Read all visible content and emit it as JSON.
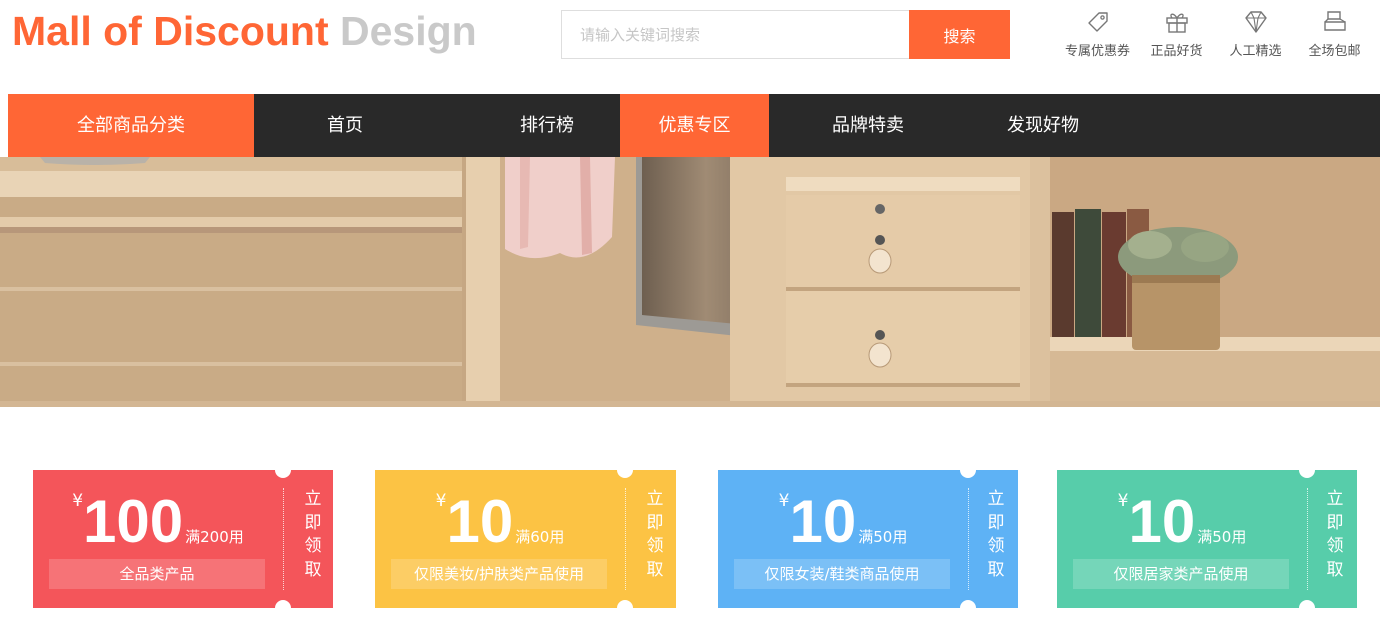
{
  "brand": {
    "part1": "Mall of Discount",
    "part2": "Design",
    "accent_color": "#ff6635"
  },
  "search": {
    "placeholder": "请输入关键词搜索",
    "value": "",
    "button_label": "搜索"
  },
  "features": [
    {
      "icon": "coupon-tag-icon",
      "label": "专属优惠券"
    },
    {
      "icon": "gift-icon",
      "label": "正品好货"
    },
    {
      "icon": "diamond-icon",
      "label": "人工精选"
    },
    {
      "icon": "shipping-box-icon",
      "label": "全场包邮"
    }
  ],
  "nav": {
    "items": [
      {
        "label": "全部商品分类",
        "active": true
      },
      {
        "label": "首页",
        "active": false
      },
      {
        "label": "排行榜",
        "active": false
      },
      {
        "label": "优惠专区",
        "active": true
      },
      {
        "label": "品牌特卖",
        "active": false
      },
      {
        "label": "发现好物",
        "active": false
      }
    ]
  },
  "banner": {
    "alt": "wooden wardrobe furniture banner"
  },
  "coupons": [
    {
      "currency": "¥",
      "amount": "100",
      "condition": "满200用",
      "scope": "全品类产品",
      "claim": [
        "立",
        "即",
        "领",
        "取"
      ],
      "color": "#f4555a"
    },
    {
      "currency": "¥",
      "amount": "10",
      "condition": "满60用",
      "scope": "仅限美妆/护肤类产品使用",
      "claim": [
        "立",
        "即",
        "领",
        "取"
      ],
      "color": "#fcc344"
    },
    {
      "currency": "¥",
      "amount": "10",
      "condition": "满50用",
      "scope": "仅限女装/鞋类商品使用",
      "claim": [
        "立",
        "即",
        "领",
        "取"
      ],
      "color": "#5eb2f5"
    },
    {
      "currency": "¥",
      "amount": "10",
      "condition": "满50用",
      "scope": "仅限居家类产品使用",
      "claim": [
        "立",
        "即",
        "领",
        "取"
      ],
      "color": "#57cdaa"
    }
  ]
}
